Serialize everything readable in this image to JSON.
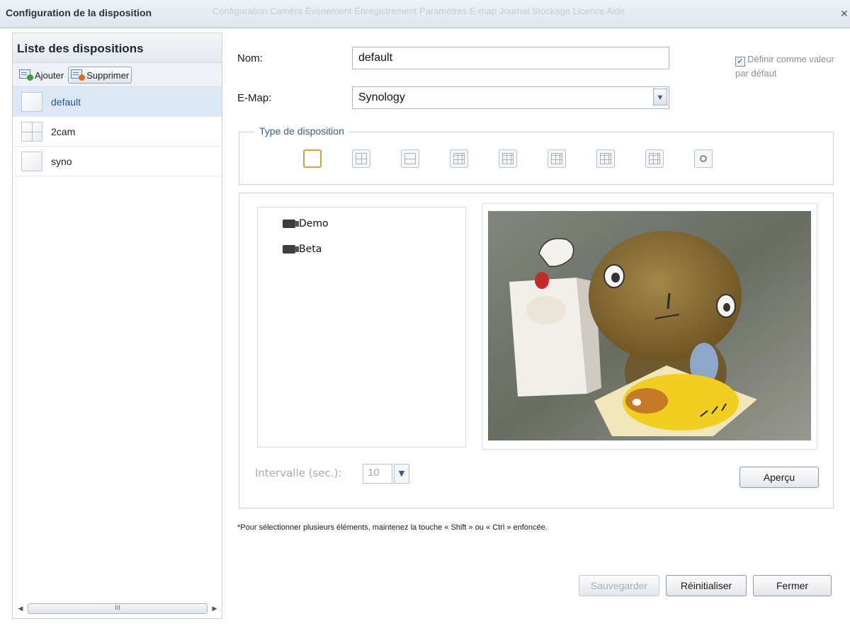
{
  "window": {
    "title": "Configuration de la disposition",
    "background_text": "Configuration  Caméra  Événement  Enregistrement  Paramètres  E-map  Journal  Stockage  Licence  Aide"
  },
  "left_panel": {
    "heading": "Liste des dispositions",
    "add_label": "Ajouter",
    "delete_label": "Supprimer",
    "items": [
      {
        "label": "default"
      },
      {
        "label": "2cam"
      },
      {
        "label": "syno"
      }
    ],
    "scrollbar_grip": "III"
  },
  "form": {
    "name_label": "Nom:",
    "name_value": "default",
    "emap_label": "E-Map:",
    "emap_value": "Synology",
    "default_checkbox_label": "Définir comme valeur par défaut",
    "layout_type_legend": "Type de disposition"
  },
  "preview": {
    "cameras": [
      "Demo",
      "Beta"
    ],
    "interval_label": "Intervalle (sec.):",
    "interval_value": "10",
    "preview_button": "Aperçu"
  },
  "footer": {
    "note": "*Pour sélectionner plusieurs éléments, maintenez la touche « Shift » ou « Ctrl » enfoncée.",
    "save_button": "Sauvegarder",
    "reset_button": "Réinitialiser",
    "close_button": "Fermer"
  },
  "colors": {
    "accent": "#3b5d86",
    "selection": "#dde8f6",
    "selected_layout_border": "#d7a23b"
  }
}
